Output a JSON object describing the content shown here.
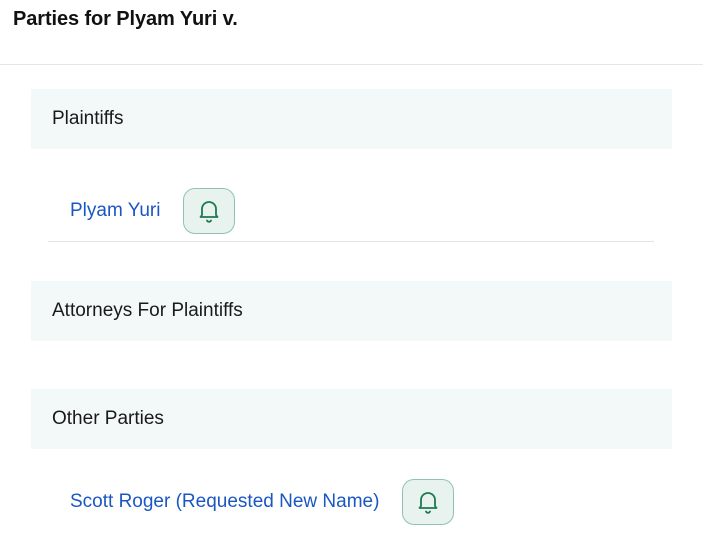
{
  "page": {
    "title": "Parties for Plyam Yuri v."
  },
  "sections": {
    "plaintiffs": {
      "heading": "Plaintiffs",
      "parties": [
        {
          "name": "Plyam Yuri",
          "icon": "bell-icon"
        }
      ]
    },
    "attorneys": {
      "heading": "Attorneys For Plaintiffs"
    },
    "other": {
      "heading": "Other Parties",
      "parties": [
        {
          "name": "Scott Roger (Requested New Name)",
          "icon": "bell-icon"
        }
      ]
    }
  },
  "colors": {
    "link": "#1a57c2",
    "section_bg": "#f3f9f8",
    "bell_bg": "#e8f3ef",
    "bell_border": "#8fc3b0",
    "bell_stroke": "#1e7a4f"
  }
}
